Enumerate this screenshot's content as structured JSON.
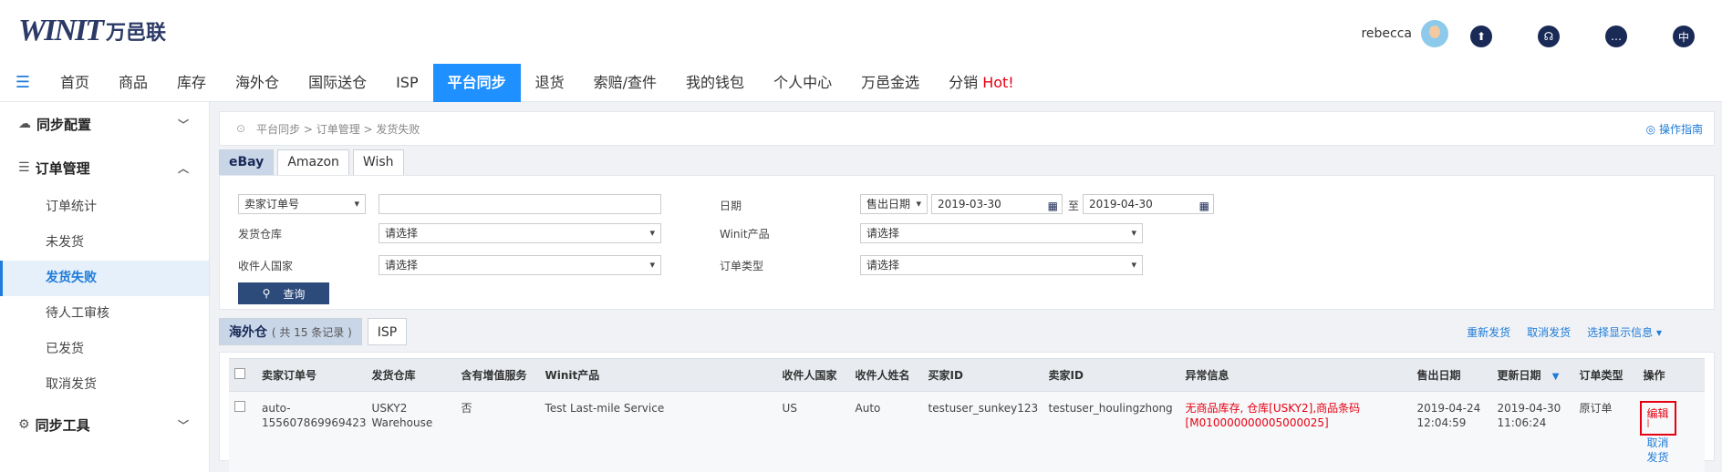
{
  "header": {
    "logo_mark": "WINIT",
    "logo_text": "万邑联",
    "username": "rebecca",
    "lang_icon_label": "中"
  },
  "nav": {
    "items": [
      "首页",
      "商品",
      "库存",
      "海外仓",
      "国际送仓",
      "ISP",
      "平台同步",
      "退货",
      "索赔/查件",
      "我的钱包",
      "个人中心",
      "万邑金选",
      "分销"
    ],
    "hot_label": "Hot!",
    "active_index": 6
  },
  "sidebar": {
    "group1": "同步配置",
    "group2": "订单管理",
    "items": [
      "订单统计",
      "未发货",
      "发货失败",
      "待人工审核",
      "已发货",
      "取消发货"
    ],
    "active_index": 2,
    "group3": "同步工具"
  },
  "breadcrumb": {
    "path": "平台同步 > 订单管理 > 发货失败",
    "guide": "操作指南"
  },
  "platform_tabs": [
    "eBay",
    "Amazon",
    "Wish"
  ],
  "filter": {
    "order_type_select": "卖家订单号",
    "order_input": "",
    "warehouse_label": "发货仓库",
    "warehouse_select": "请选择",
    "country_label": "收件人国家",
    "country_select": "请选择",
    "date_label": "日期",
    "date_type_select": "售出日期",
    "date_from": "2019-03-30",
    "date_to_label": "至",
    "date_to": "2019-04-30",
    "product_label": "Winit产品",
    "product_select": "请选择",
    "ordertype_label": "订单类型",
    "ordertype_select": "请选择",
    "query_button": "查询"
  },
  "list": {
    "tab1_label": "海外仓",
    "tab1_count": "( 共 15 条记录 )",
    "tab2_label": "ISP",
    "action_resend": "重新发货",
    "action_cancel": "取消发货",
    "action_display": "选择显示信息"
  },
  "table": {
    "headers": [
      "卖家订单号",
      "发货仓库",
      "含有增值服务",
      "Winit产品",
      "收件人国家",
      "收件人姓名",
      "买家ID",
      "卖家ID",
      "异常信息",
      "售出日期",
      "更新日期",
      "订单类型",
      "操作"
    ],
    "rows": [
      {
        "order_no_1": "auto-",
        "order_no_2": "155607869969423",
        "warehouse_1": "USKY2",
        "warehouse_2": "Warehouse",
        "value_added": "否",
        "product": "Test Last-mile Service",
        "country": "US",
        "recipient": "Auto",
        "buyer_id": "testuser_sunkey123",
        "seller_id": "testuser_houlingzhong",
        "error_1": "无商品库存, 仓库[USKY2],商品条码",
        "error_2": "[M010000000005000025]",
        "sold_date": "2019-04-24",
        "sold_time": "12:04:59",
        "update_date": "2019-04-30",
        "update_time": "11:06:24",
        "order_type": "原订单",
        "op_edit": "编辑",
        "op_sep": "|",
        "op_cancel_1": "取消",
        "op_cancel_2": "发货"
      }
    ]
  }
}
